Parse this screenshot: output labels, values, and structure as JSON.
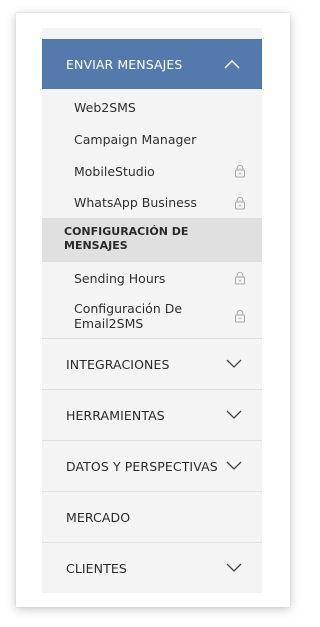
{
  "menu": {
    "active_section": {
      "label": "ENVIAR MENSAJES",
      "icon": "chevron-up-icon",
      "color": "#5479ad"
    },
    "send_items": [
      {
        "label": "Web2SMS",
        "locked": false
      },
      {
        "label": "Campaign Manager",
        "locked": false
      },
      {
        "label": "MobileStudio",
        "locked": true
      },
      {
        "label": "WhatsApp Business",
        "locked": true
      }
    ],
    "config_section": {
      "label": "CONFIGURACIÓN DE MENSAJES"
    },
    "config_items": [
      {
        "label": "Sending Hours",
        "locked": true
      },
      {
        "label": "Configuración De Email2SMS",
        "locked": true
      }
    ],
    "sections": [
      {
        "label": "INTEGRACIONES",
        "icon": "chevron-down-icon"
      },
      {
        "label": "HERRAMIENTAS",
        "icon": "chevron-down-icon"
      },
      {
        "label": "DATOS Y PERSPECTIVAS",
        "icon": "chevron-down-icon"
      },
      {
        "label": "MERCADO",
        "icon": ""
      },
      {
        "label": "CLIENTES",
        "icon": "chevron-down-icon"
      }
    ]
  }
}
